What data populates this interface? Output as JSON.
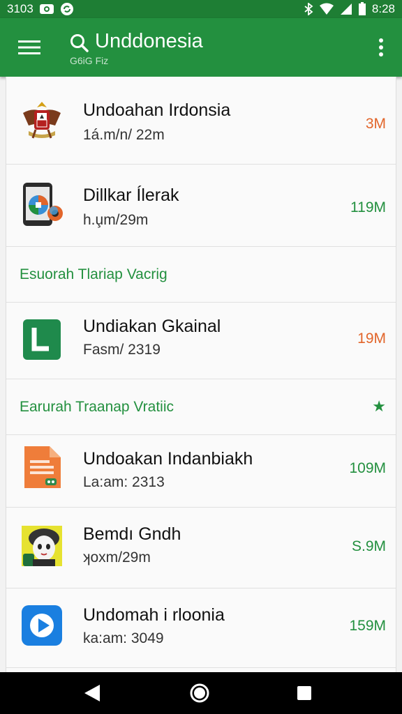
{
  "status_bar": {
    "time_left": "3103",
    "time_right": "8:28"
  },
  "app_bar": {
    "title": "Unddonesia",
    "subtitle": "G6iG Fiz"
  },
  "items": [
    {
      "name": "Undoahan Irdonsia",
      "meta": "1á.m/n/ 22m",
      "size": "3M",
      "size_color": "#e2652a",
      "icon": "garuda-emblem-icon"
    },
    {
      "name": "Dillkar Ílerak",
      "meta": "h.u̧m/29m",
      "size": "119M",
      "size_color": "#23903f",
      "icon": "phone-browser-icon"
    },
    {
      "name": "Undiakan Gkainal",
      "meta": "Fasm/ 2319",
      "size": "19M",
      "size_color": "#e2652a",
      "icon": "green-doc-icon"
    },
    {
      "name": "Undoakan Indanbiakh",
      "meta": "La:am: 2313",
      "size": "109M",
      "size_color": "#23903f",
      "icon": "orange-doc-icon"
    },
    {
      "name": "Bemdı Gndh",
      "meta": "ʞoxm/29m",
      "size": "S.9M",
      "size_color": "#23903f",
      "icon": "character-avatar-icon"
    },
    {
      "name": "Undomah i rloonia",
      "meta": "ka:am: 3049",
      "size": "159M",
      "size_color": "#23903f",
      "icon": "video-player-icon"
    }
  ],
  "sections": [
    {
      "label": "Esuorah Tlariap Vacrig"
    },
    {
      "label": "Earurah Traanap Vratiic"
    }
  ],
  "colors": {
    "primary": "#23903f",
    "status": "#1e7e34",
    "accent_orange": "#e2652a"
  }
}
